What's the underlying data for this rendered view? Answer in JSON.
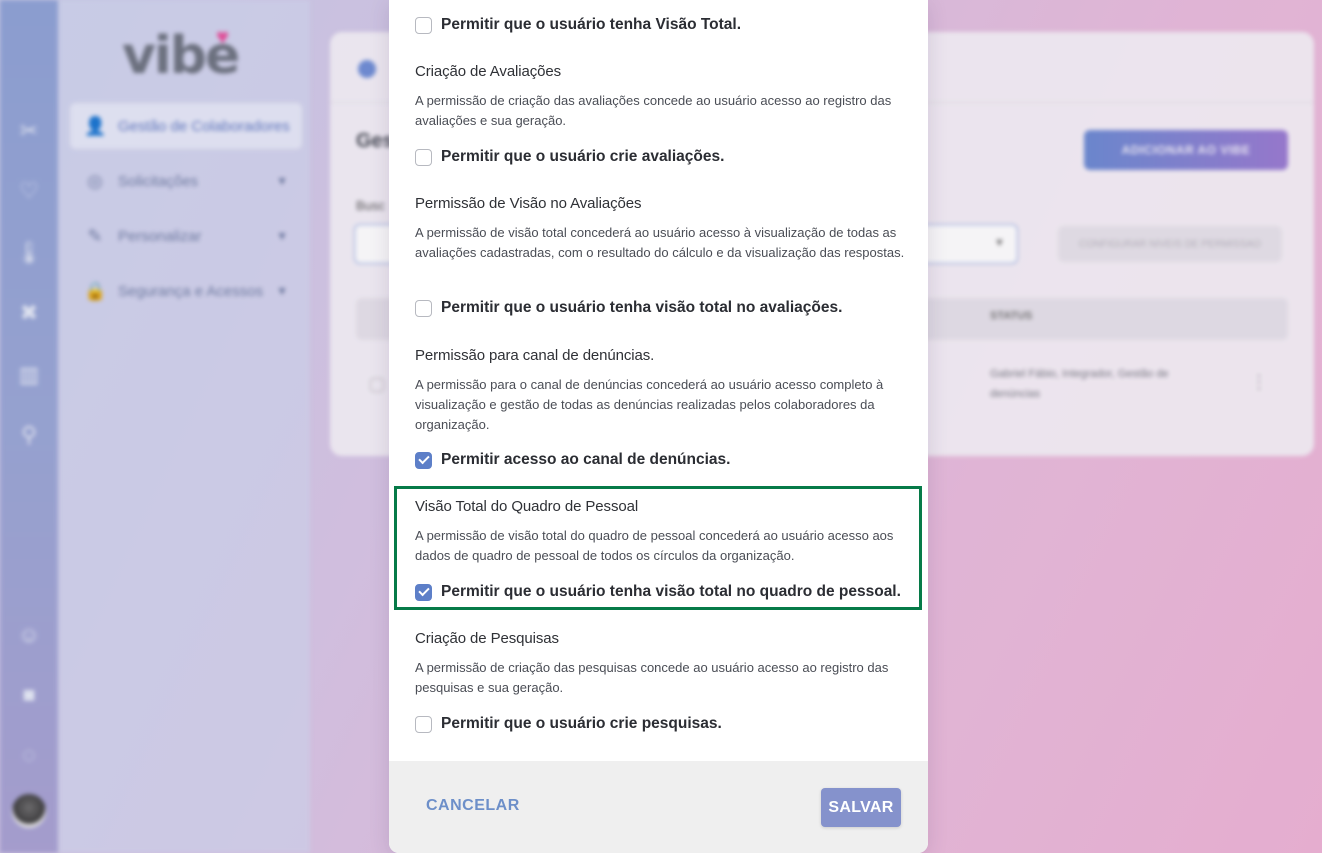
{
  "background": {
    "logo_text": "vibe",
    "sidebar": {
      "items": [
        {
          "label": "Gestão de Colaboradores",
          "icon": "users-icon"
        },
        {
          "label": "Solicitações",
          "icon": "inbox-icon"
        },
        {
          "label": "Personalizar",
          "icon": "edit-icon"
        },
        {
          "label": "Segurança e Acessos",
          "icon": "lock-icon"
        }
      ]
    },
    "card": {
      "title": "Gest",
      "add_button": "ADICIONAR AO VIBE",
      "search_label": "Busc",
      "filter_button": "CONFIGURAR NIVEIS DE PERMISSAO",
      "status_header": "STATUS",
      "row_status": "Gabriel Fábio, Integrador, Gestão de denúncias"
    }
  },
  "modal": {
    "permissions": [
      {
        "checkbox_label": "Permitir que o usuário tenha Visão Total.",
        "checked": false
      },
      {
        "title": "Criação de Avaliações",
        "description": "A permissão de criação das avaliações concede ao usuário acesso ao registro das avaliações e sua geração.",
        "checkbox_label": "Permitir que o usuário crie avaliações.",
        "checked": false
      },
      {
        "title": "Permissão de Visão no Avaliações",
        "description": "A permissão de visão total concederá ao usuário acesso à visualização de todas as avaliações cadastradas, com o resultado do cálculo e da visualização das respostas.",
        "checkbox_label": "Permitir que o usuário tenha visão total no avaliações.",
        "checked": false
      },
      {
        "title": "Permissão para canal de denúncias.",
        "description": "A permissão para o canal de denúncias concederá ao usuário acesso completo à visualização e gestão de todas as denúncias realizadas pelos colaboradores da organização.",
        "checkbox_label": "Permitir acesso ao canal de denúncias.",
        "checked": true
      },
      {
        "title": "Visão Total do Quadro de Pessoal",
        "description": "A permissão de visão total do quadro de pessoal concederá ao usuário acesso aos dados de quadro de pessoal de todos os círculos da organização.",
        "checkbox_label": "Permitir que o usuário tenha visão total no quadro de pessoal.",
        "checked": true
      },
      {
        "title": "Criação de Pesquisas",
        "description": "A permissão de criação das pesquisas concede ao usuário acesso ao registro das pesquisas e sua geração.",
        "checkbox_label": "Permitir que o usuário crie pesquisas.",
        "checked": false
      }
    ],
    "footer": {
      "cancel_label": "CANCELAR",
      "save_label": "SALVAR"
    }
  },
  "colors": {
    "accent": "#5d7fc8",
    "highlight_border": "#067a48",
    "save_button": "#8592cc",
    "cancel_text": "#6d8fc9"
  }
}
